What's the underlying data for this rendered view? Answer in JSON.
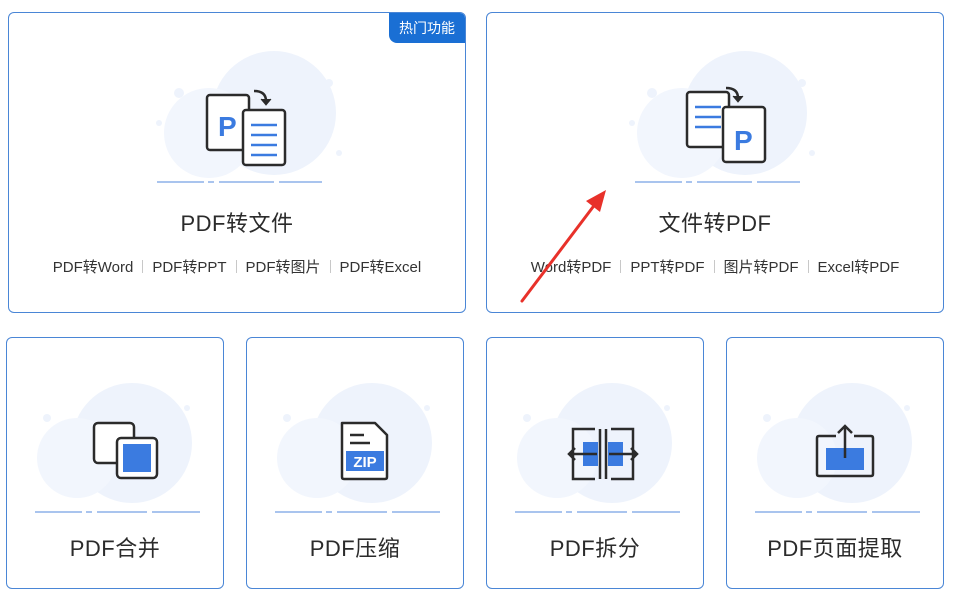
{
  "cards": {
    "pdf_to_file": {
      "title": "PDF转文件",
      "badge": "热门功能",
      "links": [
        "PDF转Word",
        "PDF转PPT",
        "PDF转图片",
        "PDF转Excel"
      ]
    },
    "file_to_pdf": {
      "title": "文件转PDF",
      "links": [
        "Word转PDF",
        "PPT转PDF",
        "图片转PDF",
        "Excel转PDF"
      ]
    },
    "pdf_merge": {
      "title": "PDF合并"
    },
    "pdf_compress": {
      "title": "PDF压缩",
      "icon_text": "ZIP"
    },
    "pdf_split": {
      "title": "PDF拆分"
    },
    "pdf_extract": {
      "title": "PDF页面提取"
    }
  },
  "colors": {
    "accent": "#1a6fd4",
    "icon_blue": "#3b7be0",
    "border": "#4a86d6",
    "annotation_arrow": "#e8312a"
  },
  "icons": {
    "pdf_to_file": "pdf-to-file-icon",
    "file_to_pdf": "file-to-pdf-icon",
    "pdf_merge": "merge-icon",
    "pdf_compress": "zip-file-icon",
    "pdf_split": "split-icon",
    "pdf_extract": "extract-page-icon"
  }
}
